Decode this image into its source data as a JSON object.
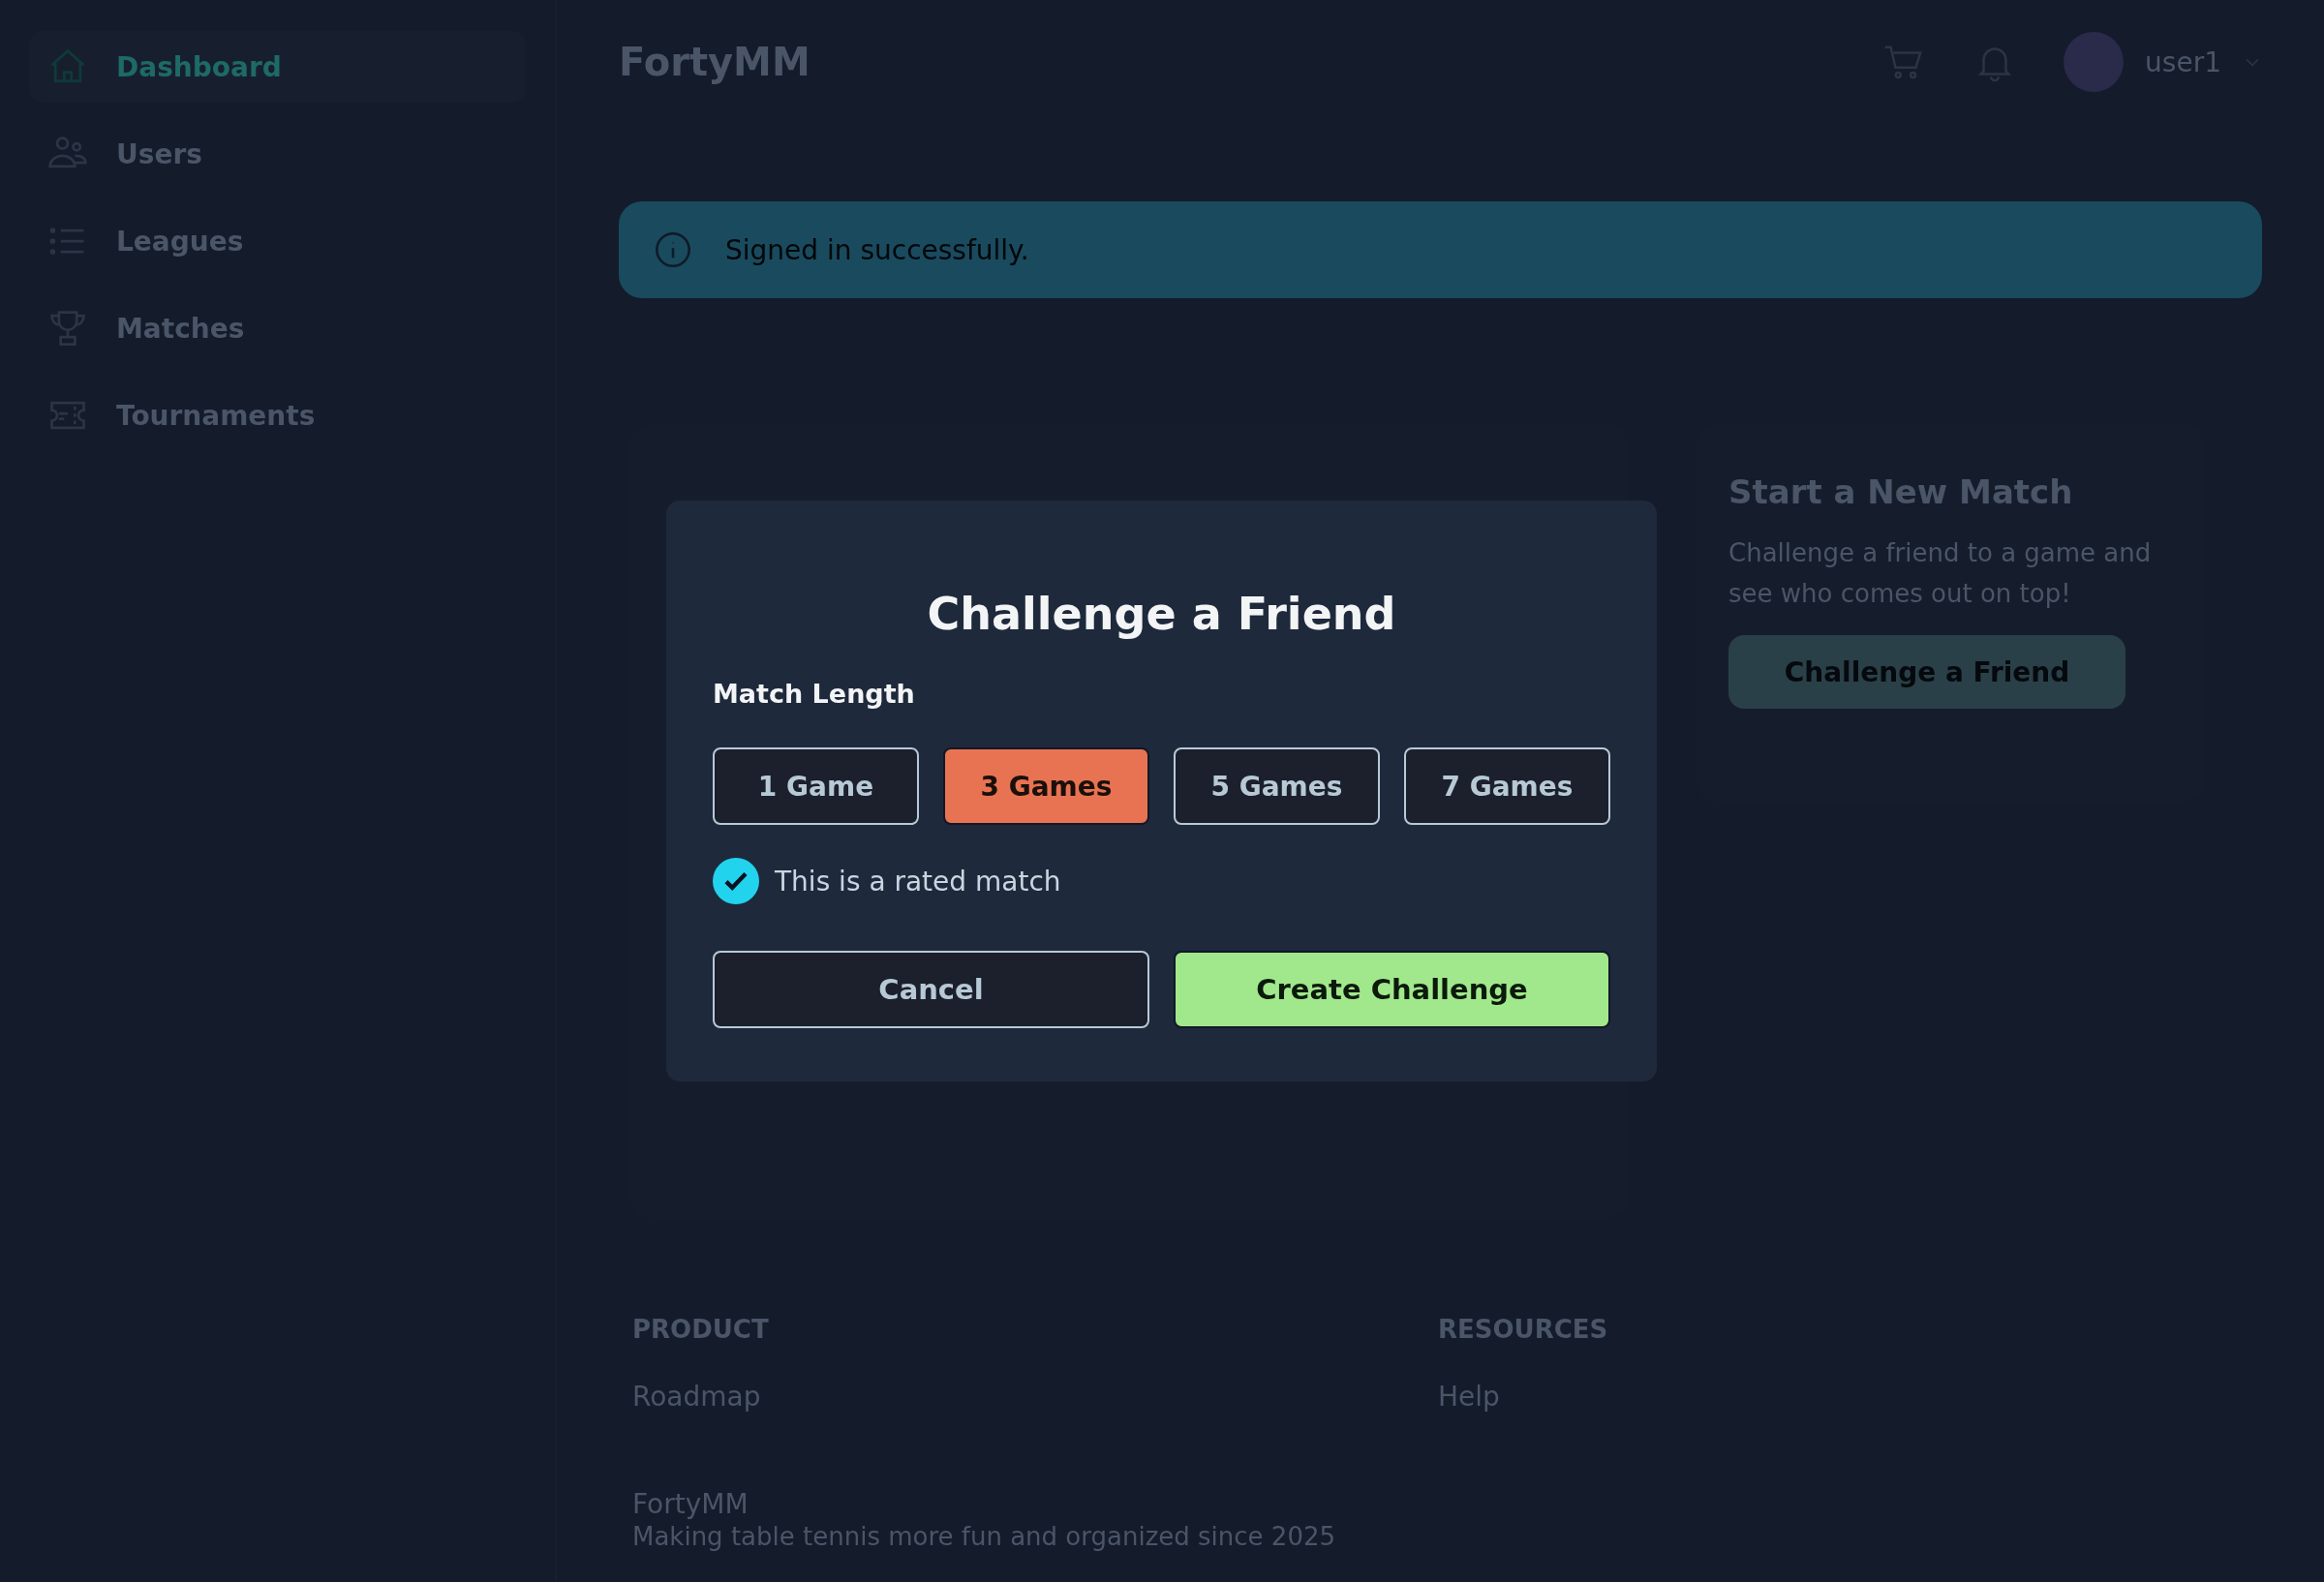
{
  "sidebar": {
    "items": [
      {
        "label": "Dashboard",
        "selected": true
      },
      {
        "label": "Users",
        "selected": false
      },
      {
        "label": "Leagues",
        "selected": false
      },
      {
        "label": "Matches",
        "selected": false
      },
      {
        "label": "Tournaments",
        "selected": false
      }
    ]
  },
  "header": {
    "brand": "FortyMM",
    "user": "user1"
  },
  "alert": {
    "message": "Signed in successfully."
  },
  "new_match_card": {
    "title": "Start a New Match",
    "text": "Challenge a friend to a game and see who comes out on top!",
    "button": "Challenge a Friend"
  },
  "footer": {
    "columns": [
      {
        "heading": "PRODUCT",
        "links": [
          "Roadmap"
        ]
      },
      {
        "heading": "RESOURCES",
        "links": [
          "Help"
        ]
      }
    ],
    "brand": "FortyMM",
    "tagline": "Making table tennis more fun and organized since 2025"
  },
  "dialog": {
    "title": "Challenge a Friend",
    "match_length_label": "Match Length",
    "options": [
      {
        "label": "1 Game",
        "selected": false
      },
      {
        "label": "3 Games",
        "selected": true
      },
      {
        "label": "5 Games",
        "selected": false
      },
      {
        "label": "7 Games",
        "selected": false
      }
    ],
    "rated": {
      "label": "This is a rated match",
      "checked": true
    },
    "cancel": "Cancel",
    "confirm": "Create Challenge"
  }
}
